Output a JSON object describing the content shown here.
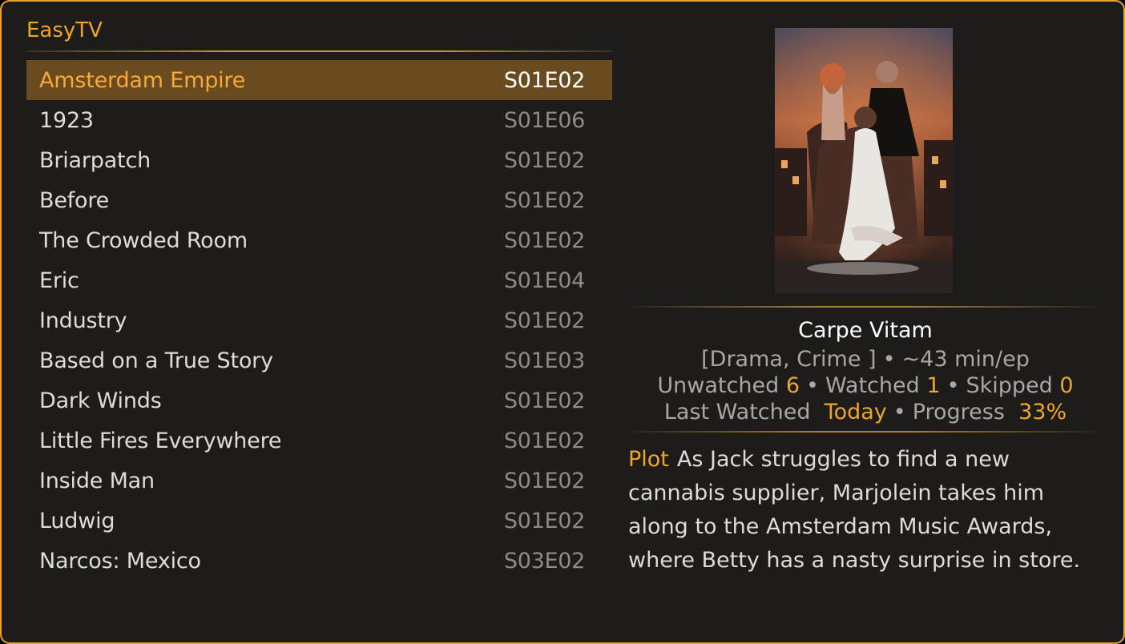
{
  "app": {
    "title": "EasyTV"
  },
  "shows": [
    {
      "name": "Amsterdam Empire",
      "episode": "S01E02",
      "selected": true
    },
    {
      "name": "1923",
      "episode": "S01E06"
    },
    {
      "name": "Briarpatch",
      "episode": "S01E02"
    },
    {
      "name": "Before",
      "episode": "S01E02"
    },
    {
      "name": "The Crowded Room",
      "episode": "S01E02"
    },
    {
      "name": "Eric",
      "episode": "S01E04"
    },
    {
      "name": "Industry",
      "episode": "S01E02"
    },
    {
      "name": "Based on a True Story",
      "episode": "S01E03"
    },
    {
      "name": "Dark Winds",
      "episode": "S01E02"
    },
    {
      "name": "Little Fires Everywhere",
      "episode": "S01E02"
    },
    {
      "name": "Inside Man",
      "episode": "S01E02"
    },
    {
      "name": "Ludwig",
      "episode": "S01E02"
    },
    {
      "name": "Narcos: Mexico",
      "episode": "S03E02"
    }
  ],
  "details": {
    "episode_title": "Carpe Vitam",
    "genre": "[Drama, Crime ]",
    "runtime": "~43 min/ep",
    "bullet": "•",
    "unwatched_label": "Unwatched",
    "unwatched_value": "6",
    "watched_label": "Watched",
    "watched_value": "1",
    "skipped_label": "Skipped",
    "skipped_value": "0",
    "last_watched_label": "Last Watched",
    "last_watched_value": "Today",
    "progress_label": "Progress",
    "progress_value": "33%",
    "plot_label": "Plot",
    "plot_text": "As Jack struggles to find a new cannabis supplier, Marjolein takes him along to the Amsterdam Music Awards, where Betty has a nasty surprise in store."
  },
  "colors": {
    "accent": "#efa52c",
    "selection": "#6a4b1f",
    "background": "#1d1c1b"
  }
}
